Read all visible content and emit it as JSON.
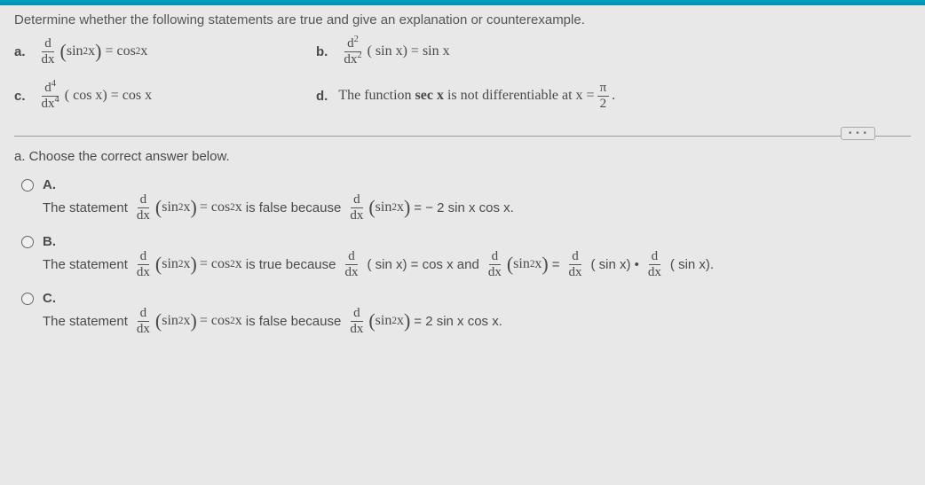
{
  "question": "Determine whether the following statements are true and give an explanation or counterexample.",
  "problems": {
    "a": {
      "label": "a.",
      "lhs_num": "d",
      "lhs_den": "dx",
      "inner": "sin",
      "exp1": "2",
      "arg": "x",
      "eq": "= cos",
      "exp2": "2",
      "arg2": "x"
    },
    "b": {
      "label": "b.",
      "lhs_num": "d",
      "lhs_num_exp": "2",
      "lhs_den": "dx",
      "lhs_den_exp": "2",
      "inner": "( sin x) = sin x"
    },
    "c": {
      "label": "c.",
      "lhs_num": "d",
      "lhs_num_exp": "4",
      "lhs_den": "dx",
      "lhs_den_exp": "4",
      "inner": "( cos x) = cos x"
    },
    "d": {
      "label": "d.",
      "text1": "The function ",
      "fn": "sec x",
      "text2": " is not differentiable at x =",
      "frac_num": "π",
      "frac_den": "2",
      "period": "."
    }
  },
  "divider_dots": "• • •",
  "sub_q": "a. Choose the correct answer below.",
  "options": {
    "A": {
      "label": "A.",
      "t1": "The statement",
      "t2": "is false because",
      "t3": "= − 2 sin x cos x."
    },
    "B": {
      "label": "B.",
      "t1": "The statement",
      "t2": "is true because",
      "t3": "( sin x) = cos x and",
      "t4": "=",
      "t5": "( sin x) •",
      "t6": "( sin x)."
    },
    "C": {
      "label": "C.",
      "t1": "The statement",
      "t2": "is false because",
      "t3": "= 2 sin x cos x."
    }
  },
  "common": {
    "ddx_num": "d",
    "ddx_den": "dx",
    "sin2x": "sin",
    "two": "2",
    "x": "x",
    "cos2x": "= cos",
    "xarg": "x"
  }
}
